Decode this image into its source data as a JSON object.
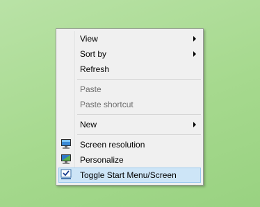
{
  "context_menu": {
    "items": [
      {
        "label": "View"
      },
      {
        "label": "Sort by"
      },
      {
        "label": "Refresh"
      },
      {
        "label": "Paste"
      },
      {
        "label": "Paste shortcut"
      },
      {
        "label": "New"
      },
      {
        "label": "Screen resolution",
        "icon": "monitor-icon"
      },
      {
        "label": "Personalize",
        "icon": "personalize-icon"
      },
      {
        "label": "Toggle Start Menu/Screen",
        "icon": "checkbox-checked-icon"
      }
    ]
  }
}
